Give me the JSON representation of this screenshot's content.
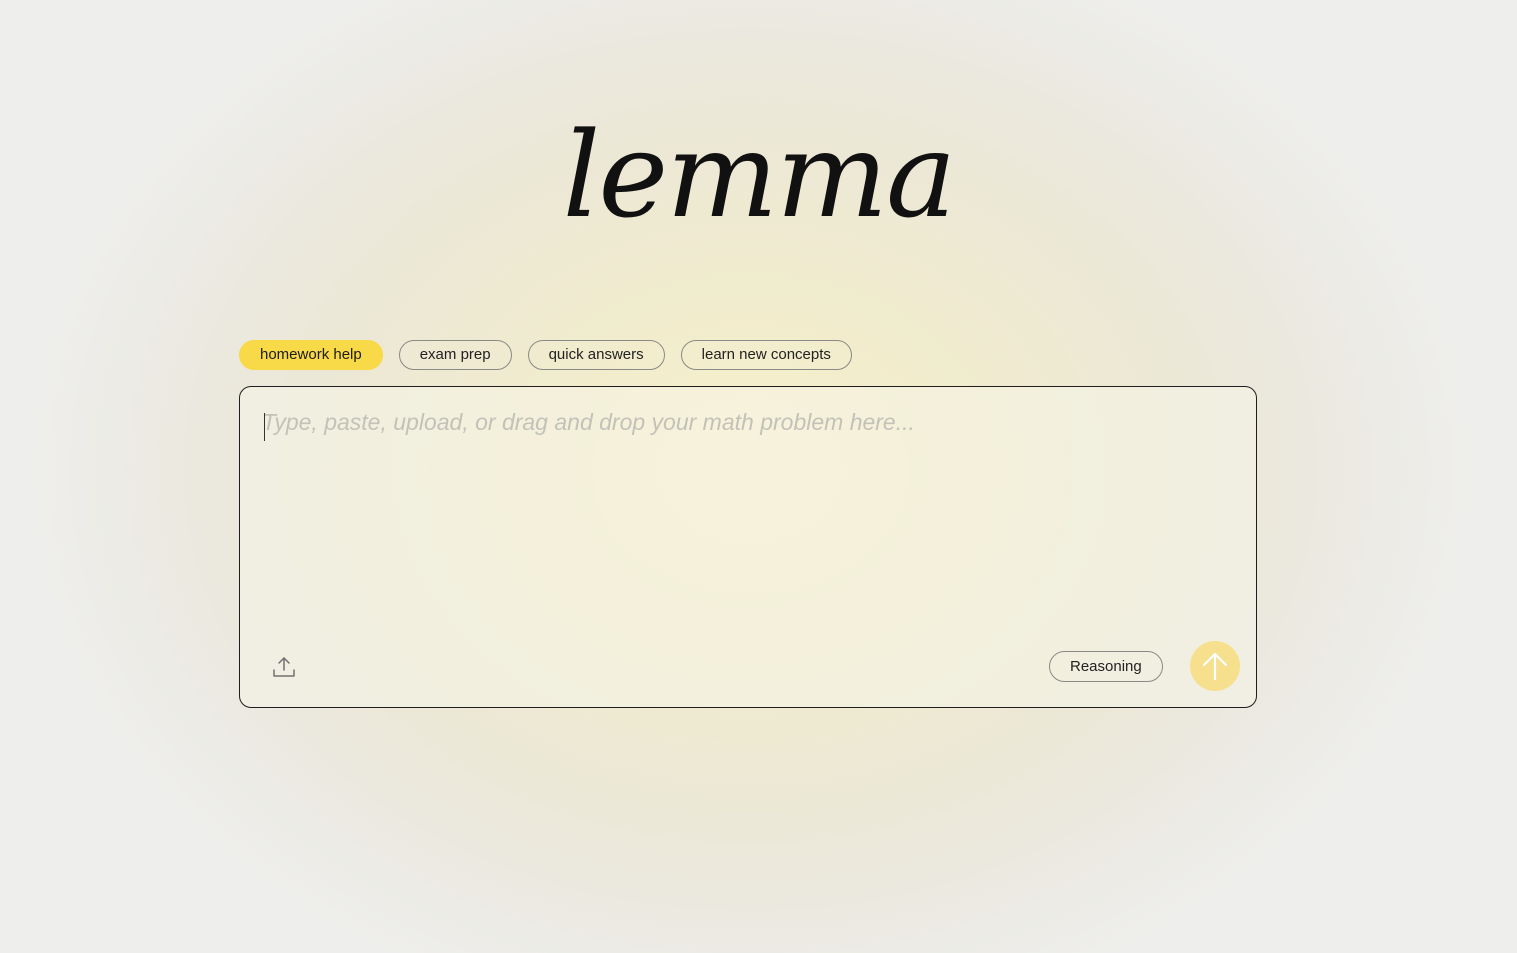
{
  "brand": {
    "logo_text": "lemma"
  },
  "modes": [
    {
      "label": "homework help",
      "active": true
    },
    {
      "label": "exam prep",
      "active": false
    },
    {
      "label": "quick answers",
      "active": false
    },
    {
      "label": "learn new concepts",
      "active": false
    }
  ],
  "composer": {
    "placeholder": "Type, paste, upload, or drag and drop your math problem here...",
    "value": "",
    "reasoning_label": "Reasoning",
    "upload_icon": "upload-icon",
    "send_icon": "arrow-up-icon"
  },
  "colors": {
    "accent": "#f8d948",
    "send_button": "#f6e08d",
    "text": "#111111"
  }
}
